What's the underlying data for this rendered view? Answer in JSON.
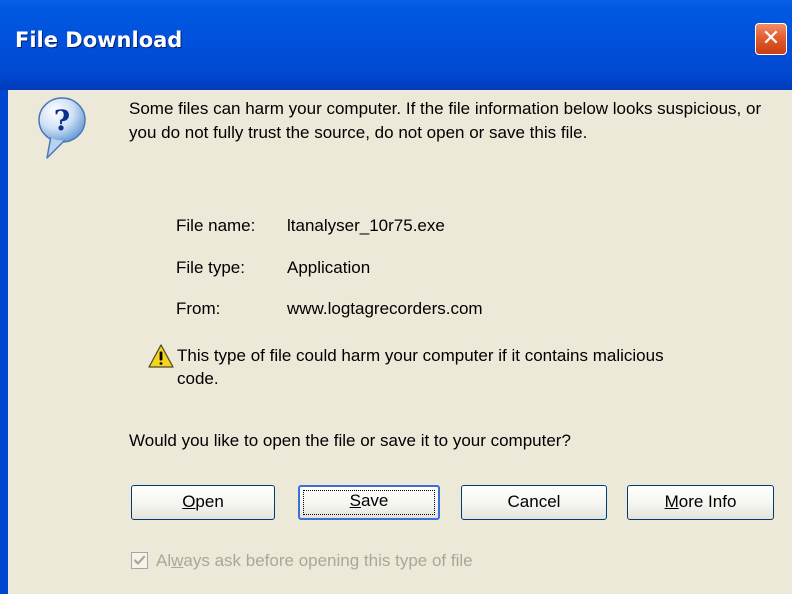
{
  "window": {
    "title": "File Download",
    "close_glyph": "✕"
  },
  "icons": {
    "question": "question-icon",
    "warning": "warning-icon",
    "close": "close-icon"
  },
  "message": {
    "intro": "Some files can harm your computer. If the file information below looks suspicious, or you do not fully trust the source, do not open or save this file."
  },
  "file_info": {
    "name_label": "File name:",
    "name_value": "ltanalyser_10r75.exe",
    "type_label": "File type:",
    "type_value": "Application",
    "from_label": "From:",
    "from_value": "www.logtagrecorders.com"
  },
  "warning": {
    "text": "This type of file could harm your computer if it contains malicious code."
  },
  "prompt": {
    "question": "Would you like to open the file or save it to your computer?"
  },
  "buttons": {
    "open_access": "O",
    "open_rest": "pen",
    "save_access": "S",
    "save_rest": "ave",
    "cancel": "Cancel",
    "moreinfo_access": "M",
    "moreinfo_rest": "ore Info"
  },
  "checkbox": {
    "label_pre": "Al",
    "label_access": "w",
    "label_post": "ays ask before opening this type of file",
    "checked": true,
    "enabled": false
  },
  "colors": {
    "titlebar": "#0050d8",
    "dialog_bg": "#ece9d8",
    "close_button": "#e35d2e",
    "disabled_text": "#a9a898"
  }
}
